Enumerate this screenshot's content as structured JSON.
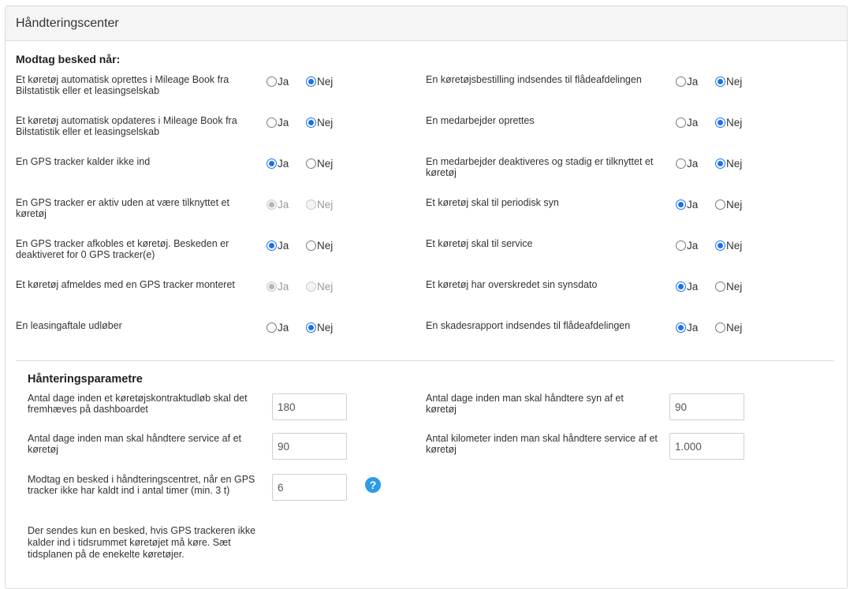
{
  "panel": {
    "title": "Håndteringscenter"
  },
  "notify": {
    "title": "Modtag besked når:",
    "yes_label": "Ja",
    "no_label": "Nej",
    "left": [
      {
        "label": "Et køretøj automatisk oprettes i Mileage Book fra Bilstatistik eller et leasingselskab",
        "value": "no",
        "disabled": false
      },
      {
        "label": "Et køretøj automatisk opdateres i Mileage Book fra Bilstatistik eller et leasingselskab",
        "value": "no",
        "disabled": false
      },
      {
        "label": "En GPS tracker kalder ikke ind",
        "value": "yes",
        "disabled": false
      },
      {
        "label": "En GPS tracker er aktiv uden at være tilknyttet et køretøj",
        "value": "yes",
        "disabled": true
      },
      {
        "label": "En GPS tracker afkobles et køretøj. Beskeden er deaktiveret for 0 GPS tracker(e)",
        "value": "yes",
        "disabled": false
      },
      {
        "label": "Et køretøj afmeldes med en GPS tracker monteret",
        "value": "yes",
        "disabled": true
      },
      {
        "label": "En leasingaftale udløber",
        "value": "no",
        "disabled": false
      }
    ],
    "right": [
      {
        "label": "En køretøjsbestilling indsendes til flådeafdelingen",
        "value": "no",
        "disabled": false
      },
      {
        "label": "En medarbejder oprettes",
        "value": "no",
        "disabled": false
      },
      {
        "label": "En medarbejder deaktiveres og stadig er tilknyttet et køretøj",
        "value": "no",
        "disabled": false
      },
      {
        "label": "Et køretøj skal til periodisk syn",
        "value": "yes",
        "disabled": false
      },
      {
        "label": "Et køretøj skal til service",
        "value": "no",
        "disabled": false
      },
      {
        "label": "Et køretøj har overskredet sin synsdato",
        "value": "yes",
        "disabled": false
      },
      {
        "label": "En skadesrapport indsendes til flådeafdelingen",
        "value": "yes",
        "disabled": false
      }
    ]
  },
  "params": {
    "title": "Hånteringsparametre",
    "contract_days": {
      "label": "Antal dage inden et køretøjskontraktudløb skal det fremhæves på dashboardet",
      "value": "180"
    },
    "inspection_days": {
      "label": "Antal dage inden man skal håndtere syn af et køretøj",
      "value": "90"
    },
    "service_days": {
      "label": "Antal dage inden man skal håndtere service af et køretøj",
      "value": "90"
    },
    "service_km": {
      "label": "Antal kilometer inden man skal håndtere service af et køretøj",
      "value": "1.000"
    },
    "gps_hours": {
      "label": "Modtag en besked i håndteringscentret, når en GPS tracker ikke har kaldt ind i antal timer (min. 3 t)",
      "value": "6"
    },
    "help_icon": "question-circle-icon",
    "note": "Der sendes kun en besked, hvis GPS trackeren ikke kalder ind i tidsrummet køretøjet må køre. Sæt tidsplanen på de enekelte køretøjer."
  },
  "colors": {
    "accent": "#1a73e8",
    "help": "#2e9be6",
    "header_bg": "#f5f5f5",
    "border": "#dcdcdc"
  }
}
